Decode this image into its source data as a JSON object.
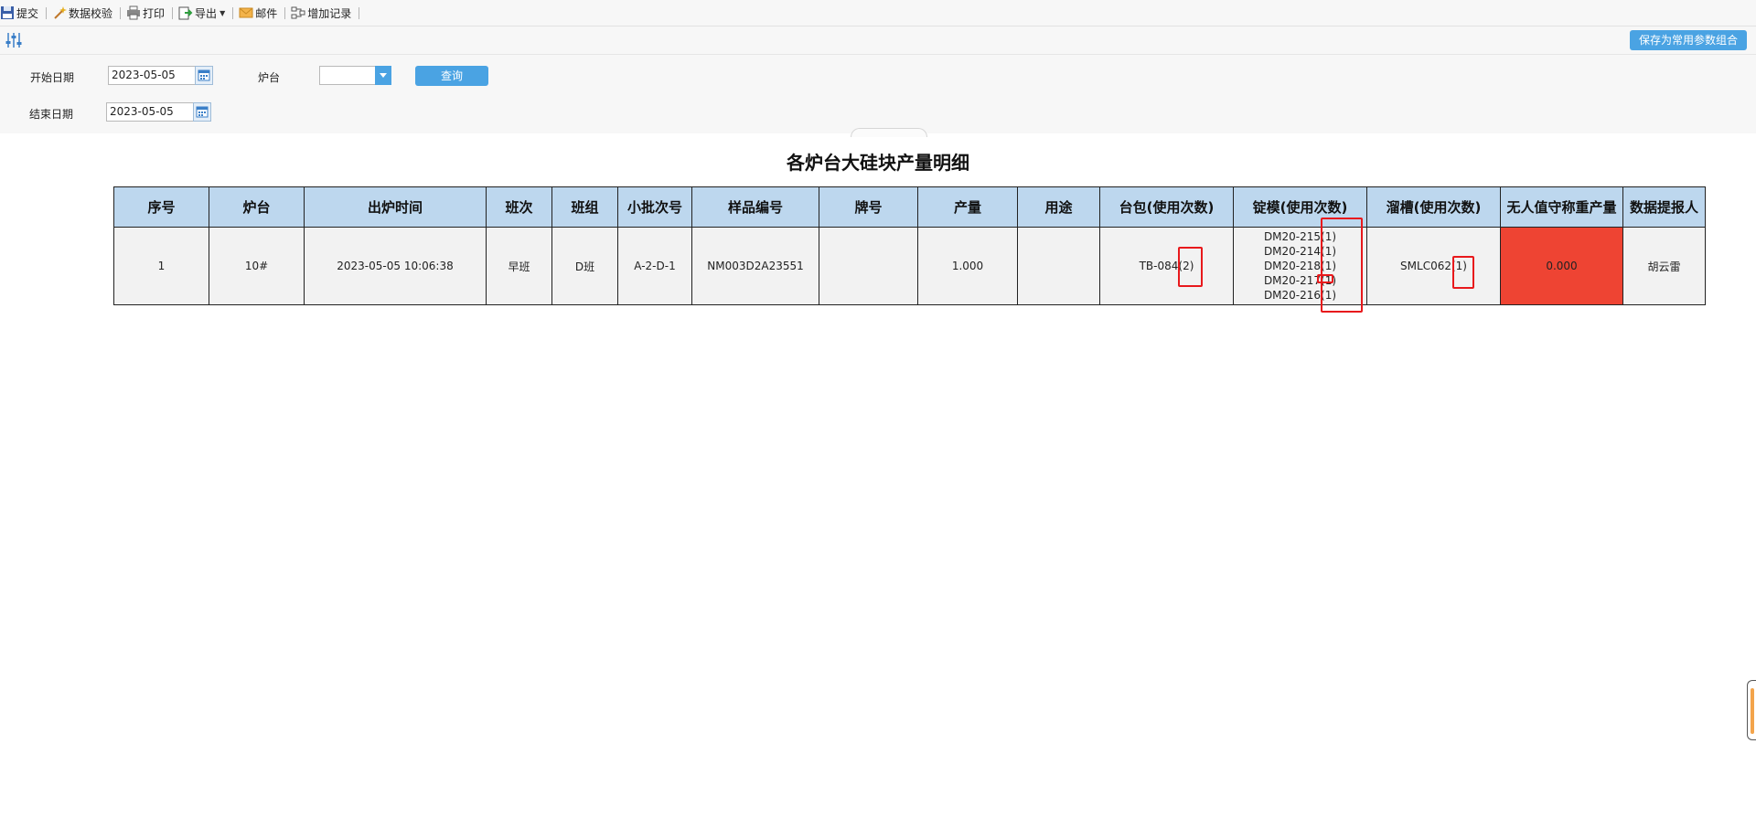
{
  "toolbar": {
    "items": [
      {
        "label": "提交",
        "icon": "save-icon"
      },
      {
        "label": "数据校验",
        "icon": "wand-icon"
      },
      {
        "label": "打印",
        "icon": "printer-icon"
      },
      {
        "label": "导出",
        "icon": "export-icon"
      },
      {
        "label": "邮件",
        "icon": "mail-icon"
      },
      {
        "label": "增加记录",
        "icon": "add-record-icon"
      }
    ]
  },
  "subbar": {
    "save_combo_label": "保存为常用参数组合",
    "filter_icon": "sliders-icon"
  },
  "query": {
    "start_date_label": "开始日期",
    "start_date_value": "2023-05-05",
    "end_date_label": "结束日期",
    "end_date_value": "2023-05-05",
    "furnace_label": "炉台",
    "furnace_value": "",
    "query_button": "查询"
  },
  "report": {
    "title": "各炉台大硅块产量明细",
    "columns": [
      "序号",
      "炉台",
      "出炉时间",
      "班次",
      "班组",
      "小批次号",
      "样品编号",
      "牌号",
      "产量",
      "用途",
      "台包(使用次数)",
      "锭模(使用次数)",
      "溜槽(使用次数)",
      "无人值守称重产量",
      "数据提报人"
    ],
    "rows": [
      {
        "seq": "1",
        "furnace": "10#",
        "time": "2023-05-05 10:06:38",
        "shift": "早班",
        "team": "D班",
        "batch": "A-2-D-1",
        "sample": "NM003D2A23551",
        "grade": "",
        "output": "1.000",
        "usage": "",
        "ladle": "TB-084(2)",
        "molds": [
          "DM20-215(1)",
          "DM20-214(1)",
          "DM20-218(1)",
          "DM20-217(1)",
          "DM20-216(1)"
        ],
        "chute": "SMLC062(1)",
        "auto_weight": "0.000",
        "reporter": "胡云雷"
      }
    ]
  },
  "colors": {
    "accent": "#4aa3e3",
    "header_bg": "#bdd7ee",
    "cell_bg": "#f2f2f2",
    "alert": "#ee4433",
    "highlight": "#e8191c"
  }
}
